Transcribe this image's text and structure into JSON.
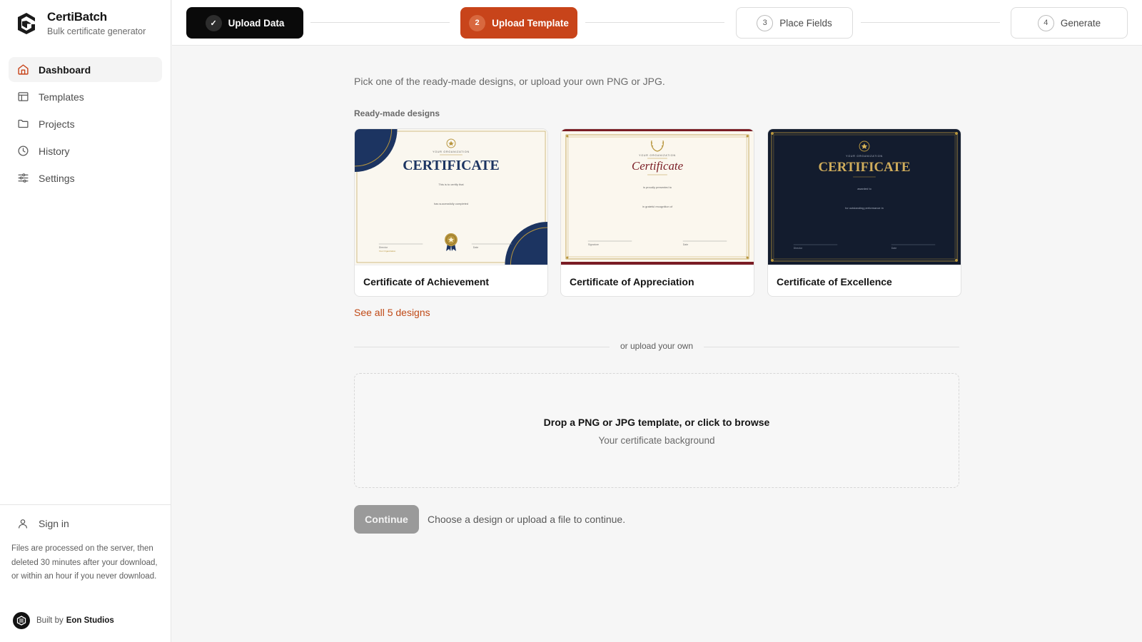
{
  "brand": {
    "name": "CertiBatch",
    "tagline": "Bulk certificate generator"
  },
  "sidebar": {
    "items": [
      {
        "label": "Dashboard",
        "icon": "home-icon",
        "active": true
      },
      {
        "label": "Templates",
        "icon": "layout-icon",
        "active": false
      },
      {
        "label": "Projects",
        "icon": "folder-icon",
        "active": false
      },
      {
        "label": "History",
        "icon": "clock-icon",
        "active": false
      },
      {
        "label": "Settings",
        "icon": "sliders-icon",
        "active": false
      }
    ],
    "signin_label": "Sign in",
    "notice": "Files are processed on the server, then deleted 30 minutes after your download, or within an hour if you never download.",
    "built_prefix": "Built by",
    "built_by": "Eon Studios"
  },
  "stepper": {
    "steps": [
      {
        "number": "✓",
        "label": "Upload Data",
        "state": "done"
      },
      {
        "number": "2",
        "label": "Upload Template",
        "state": "current"
      },
      {
        "number": "3",
        "label": "Place Fields",
        "state": "todo"
      },
      {
        "number": "4",
        "label": "Generate",
        "state": "todo"
      }
    ]
  },
  "main": {
    "intro": "Pick one of the ready-made designs, or upload your own PNG or JPG.",
    "designs_label": "Ready-made designs",
    "designs": [
      {
        "title": "Certificate of Achievement",
        "thumb": {
          "org": "YOUR ORGANIZATION",
          "heading": "CERTIFICATE",
          "line1": "This is to certify that",
          "line2": "has successfully completed",
          "sig1": "Director",
          "sig1_sub": "Your Organization",
          "sig2": "Date"
        }
      },
      {
        "title": "Certificate of Appreciation",
        "thumb": {
          "org": "YOUR ORGANIZATION",
          "heading": "Certificate",
          "line1": "is proudly presented to",
          "line2": "in grateful recognition of",
          "sig1": "Signature",
          "sig2": "Date"
        }
      },
      {
        "title": "Certificate of Excellence",
        "thumb": {
          "org": "YOUR ORGANIZATION",
          "heading": "CERTIFICATE",
          "line1": "awarded to",
          "line2": "for outstanding performance in",
          "sig1": "Director",
          "sig2": "Date"
        }
      }
    ],
    "see_all": "See all 5 designs",
    "divider_label": "or upload your own",
    "dropzone_title": "Drop a PNG or JPG template, or click to browse",
    "dropzone_sub": "Your certificate background",
    "continue_label": "Continue",
    "continue_hint": "Choose a design or upload a file to continue."
  },
  "colors": {
    "accent": "#c8441a",
    "navy": "#1c3461",
    "gold": "#b8963e",
    "burgundy": "#7a1c24",
    "dark_navy": "#131c2e"
  }
}
